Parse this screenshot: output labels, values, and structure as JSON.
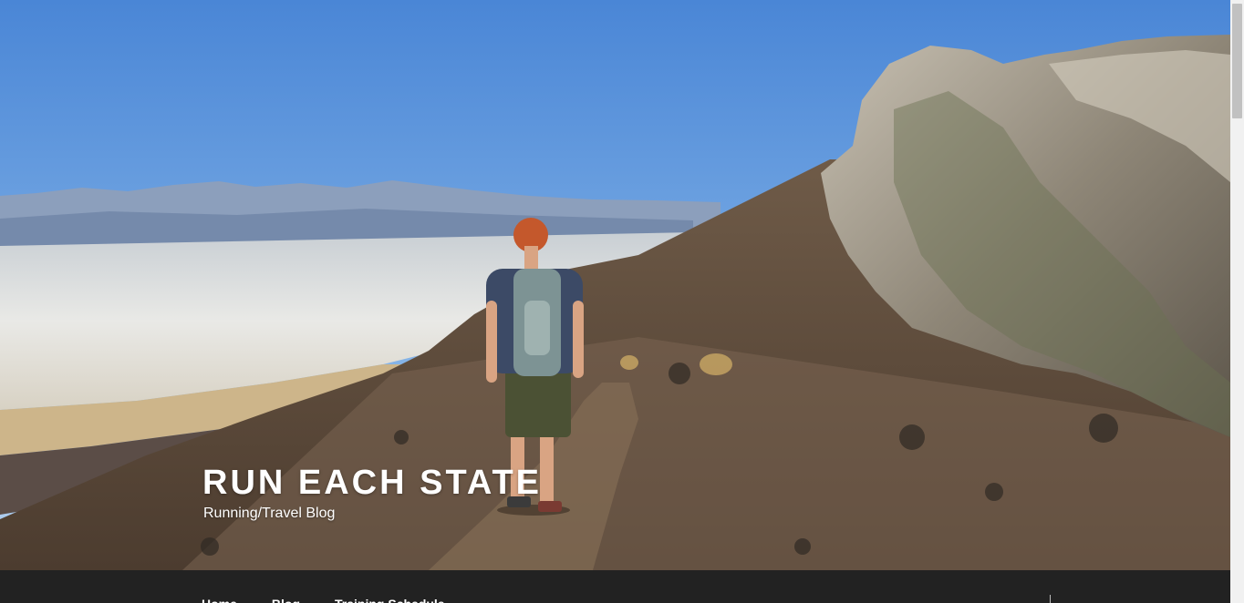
{
  "site": {
    "title": "RUN EACH STATE",
    "description": "Running/Travel Blog"
  },
  "hero": {
    "icon": "hiker-on-mountain-ridge-photo"
  },
  "nav": {
    "items": [
      {
        "label": "Home"
      },
      {
        "label": "Blog"
      },
      {
        "label": "Training Schedule"
      }
    ]
  },
  "colors": {
    "nav_bg": "#222222",
    "title_text": "#ffffff",
    "scrollbar_track": "#f1f1f1",
    "scrollbar_thumb": "#c1c1c1"
  }
}
